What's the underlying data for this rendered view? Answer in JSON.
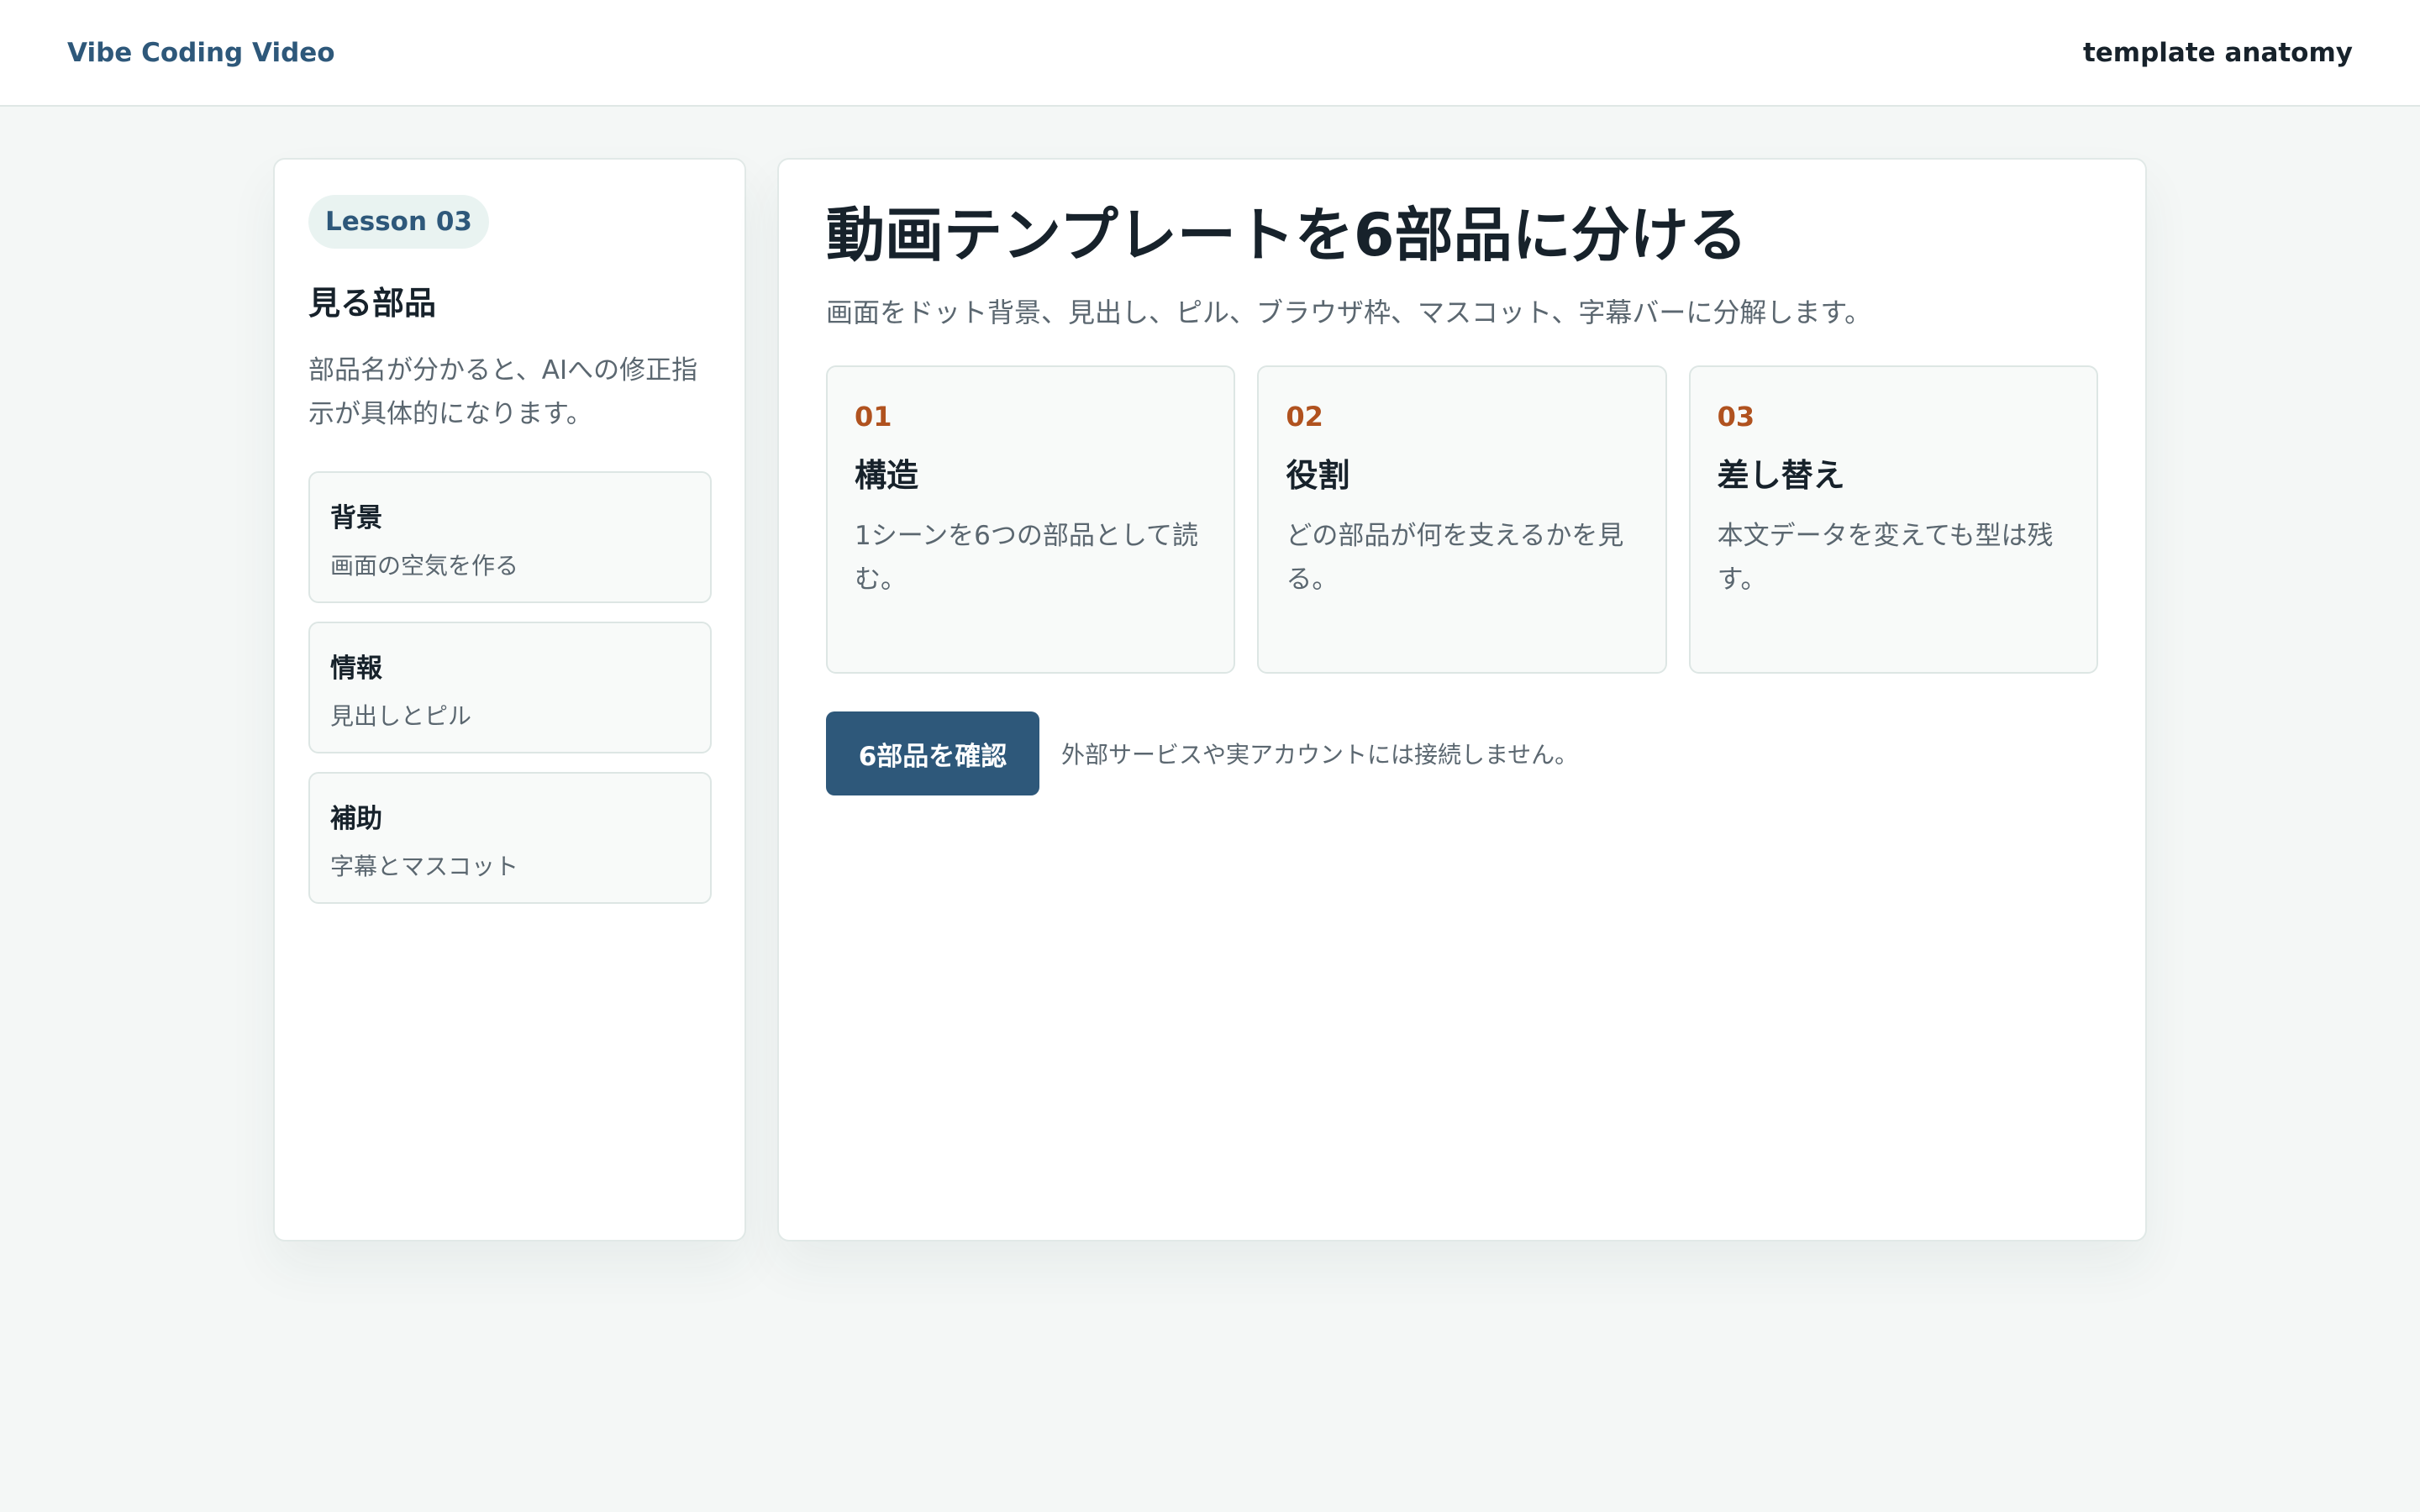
{
  "header": {
    "brand": "Vibe Coding Video",
    "right_label": "template anatomy"
  },
  "sidebar": {
    "lesson_badge": "Lesson 03",
    "title": "見る部品",
    "description": "部品名が分かると、AIへの修正指示が具体的になります。",
    "items": [
      {
        "title": "背景",
        "subtitle": "画面の空気を作る"
      },
      {
        "title": "情報",
        "subtitle": "見出しとピル"
      },
      {
        "title": "補助",
        "subtitle": "字幕とマスコット"
      }
    ]
  },
  "main": {
    "title": "動画テンプレートを6部品に分ける",
    "subtitle": "画面をドット背景、見出し、ピル、ブラウザ枠、マスコット、字幕バーに分解します。",
    "cards": [
      {
        "number": "01",
        "title": "構造",
        "description": "1シーンを6つの部品として読む。"
      },
      {
        "number": "02",
        "title": "役割",
        "description": "どの部品が何を支えるかを見る。"
      },
      {
        "number": "03",
        "title": "差し替え",
        "description": "本文データを変えても型は残す。"
      }
    ],
    "confirm_button": "6部品を確認",
    "note": "外部サービスや実アカウントには接続しません。"
  },
  "colors": {
    "background": "#f4f7f6",
    "brand": "#2e587a",
    "accent_number": "#b0521f",
    "text_primary": "#17222b",
    "text_secondary": "#5b6770"
  }
}
